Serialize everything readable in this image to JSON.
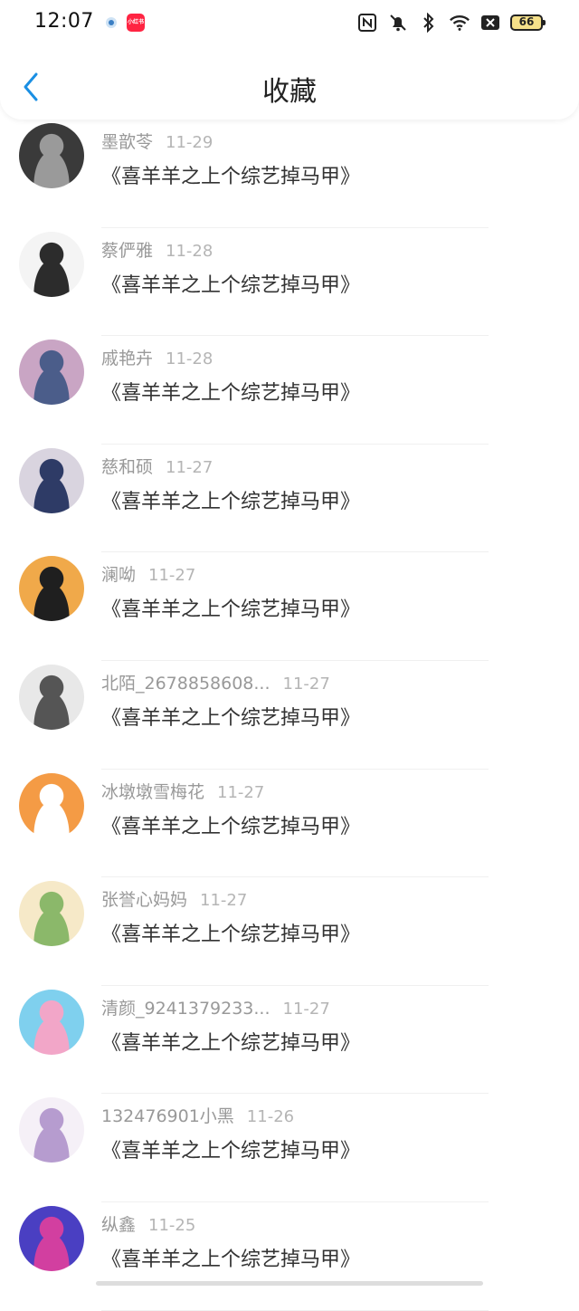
{
  "status_bar": {
    "time": "12:07",
    "notification_icons": [
      "app-notification-icon",
      "xiaohongshu-icon"
    ],
    "xiaohongshu_label": "小红书",
    "right_icons": [
      "nfc-icon",
      "mute-bell-icon",
      "bluetooth-icon",
      "wifi-icon",
      "sim-off-icon"
    ],
    "battery_level": "66",
    "battery_color": "#f5e08a"
  },
  "nav": {
    "back_icon": "chevron-left-icon",
    "title": "收藏",
    "accent": "#1a8fe3"
  },
  "items": [
    {
      "user": "墨歆苓",
      "date": "11-29",
      "title": "《喜羊羊之上个综艺掉马甲》",
      "avatar_colors": [
        "#3a3a3a",
        "#9a9a9a"
      ]
    },
    {
      "user": "蔡俨雅",
      "date": "11-28",
      "title": "《喜羊羊之上个综艺掉马甲》",
      "avatar_colors": [
        "#f4f4f4",
        "#2c2c2c"
      ]
    },
    {
      "user": "戚艳卉",
      "date": "11-28",
      "title": "《喜羊羊之上个综艺掉马甲》",
      "avatar_colors": [
        "#c9a5c4",
        "#4b5d8a"
      ]
    },
    {
      "user": "慈和硕",
      "date": "11-27",
      "title": "《喜羊羊之上个综艺掉马甲》",
      "avatar_colors": [
        "#d9d4df",
        "#2e3b66"
      ]
    },
    {
      "user": "澜呦",
      "date": "11-27",
      "title": "《喜羊羊之上个综艺掉马甲》",
      "avatar_colors": [
        "#f0a94a",
        "#1f1f1f"
      ]
    },
    {
      "user": "北陌_2678858608...",
      "date": "11-27",
      "title": "《喜羊羊之上个综艺掉马甲》",
      "avatar_colors": [
        "#e8e8e8",
        "#555555"
      ]
    },
    {
      "user": "冰墩墩雪梅花",
      "date": "11-27",
      "title": "《喜羊羊之上个综艺掉马甲》",
      "avatar_colors": [
        "#f49b45",
        "#ffffff"
      ]
    },
    {
      "user": "张誉心妈妈",
      "date": "11-27",
      "title": "《喜羊羊之上个综艺掉马甲》",
      "avatar_colors": [
        "#f6e9c8",
        "#8bb86a"
      ]
    },
    {
      "user": "清颜_9241379233...",
      "date": "11-27",
      "title": "《喜羊羊之上个综艺掉马甲》",
      "avatar_colors": [
        "#7fd0ee",
        "#f2a6c8"
      ]
    },
    {
      "user": "132476901小黑",
      "date": "11-26",
      "title": "《喜羊羊之上个综艺掉马甲》",
      "avatar_colors": [
        "#f5f0f7",
        "#b69ccf"
      ]
    },
    {
      "user": "纵鑫",
      "date": "11-25",
      "title": "《喜羊羊之上个综艺掉马甲》",
      "avatar_colors": [
        "#4a3fc2",
        "#d23fa0"
      ]
    }
  ]
}
